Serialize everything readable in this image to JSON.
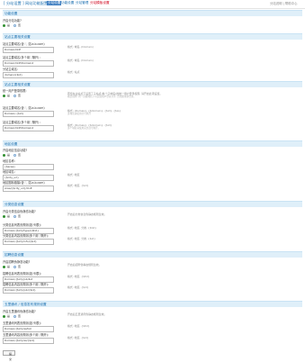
{
  "header": {
    "title": "[ 分站设置 ] 网站功能配置 - 功能",
    "tabs": [
      "分站设置",
      "功能设置",
      "分站管理",
      "分站模板设置"
    ],
    "right": "分站说明  |  帮助中心"
  },
  "sections": [
    {
      "title": "功能设置",
      "rows": [
        {
          "label": "开启分站功能?",
          "type": "radio",
          "options": [
            "是",
            "否"
          ],
          "selected": 0
        }
      ]
    },
    {
      "title": "站点主要相关设置",
      "rows": [
        {
          "label": "站点主要域名(含'.', 如.a.b.com)",
          "type": "input",
          "value": "Domain/OnE",
          "hint": "格式: 域名, (Domain)"
        },
        {
          "label": "站点主要域名(多个用','隔开) :",
          "type": "input",
          "value": "Domain/OnE/Domain2",
          "hint": "格式: 域名, (Domain)"
        },
        {
          "label": "分站主域名:",
          "type": "input",
          "value": "domain/{$id}",
          "hint": "格式: 站点"
        }
      ]
    },
    {
      "title": "站点主要相关设置",
      "rows": [
        {
          "label": "统一用户登录权限:",
          "type": "radio",
          "options": [
            "是",
            "否"
          ],
          "selected": 0,
          "hint": "若您在主站点下设置了子站点(各个子域名)的统一用户登录权限, 请开启此项设置。",
          "hint2": "格式说明: 同一顶级域名下可实现用户登录共享, 否则需重新登录。"
        },
        {
          "label": "站点主要域名(含'.', 如.a.b.com)",
          "type": "input",
          "value": "Domain/.{$id}",
          "hint": "格式: (Domain), {$domain}, {$id}, {$ip}",
          "hint2": "多域名请使用分号隔开"
        },
        {
          "label": "站点主要域名(多个用','隔开) :",
          "type": "input",
          "value": "Domain/OnE/Domain2",
          "hint": "格式: (Domain), {$domain}, {$id}",
          "hint2": "多个域名请使用英文逗号隔开。"
        }
      ]
    },
    {
      "title": "地区设置",
      "rows": [
        {
          "label": "开启地区信息功能?",
          "type": "radio",
          "options": [
            "是",
            "否"
          ],
          "selected": 0
        },
        {
          "label": "地区名称:",
          "type": "input",
          "value": "{$area}"
        },
        {
          "label": "地区域名:",
          "type": "input",
          "value": "{$city_url}",
          "hint": "格式: 地区"
        },
        {
          "label": "地区图标链接(含'.', 如.a.b.com)",
          "type": "input",
          "value": "Area/{$city_url}/OnE",
          "hint": "格式: 地区, {$id}"
        }
      ]
    },
    {
      "title": "分类信息设置",
      "rows": [
        {
          "label": "开启分类信息伪静态功能?",
          "type": "radio",
          "options": [
            "是",
            "否"
          ],
          "selected": 0,
          "hint": "开启后分类信息伪静态规则生效。"
        },
        {
          "label": "分类信息列表页规则(如:列表):",
          "type": "input",
          "value": "Domain/{$id}/type/{$tid}",
          "hint": "格式: 地区, 分类, {$tid}"
        },
        {
          "label": "分类信息内容页规则(多个用','隔开):",
          "type": "input",
          "value": "Domain/{$id}/info/{$id}",
          "hint": "格式: 地区, 分类, {$id}"
        }
      ]
    },
    {
      "title": "招聘信息设置",
      "rows": [
        {
          "label": "开启招聘伪静态功能?",
          "type": "radio",
          "options": [
            "是",
            "否"
          ],
          "selected": 0,
          "hint": "开启后招聘伪静态规则生效。"
        },
        {
          "label": "招聘信息列表页规则(如:列表):",
          "type": "input",
          "value": "Domain/{$id}/job/list",
          "hint": "格式: 地区, {$tid}"
        },
        {
          "label": "招聘信息内容页规则(多个用','隔开):",
          "type": "input",
          "value": "Domain/{$id}/job/{$id}",
          "hint": "格式: 地区, {$id}"
        }
      ]
    },
    {
      "title": "五里通讯 / 信息发布规则设置",
      "rows": [
        {
          "label": "开启五里通讯伪静态功能?",
          "type": "radio",
          "options": [
            "是",
            "否"
          ],
          "selected": 0,
          "hint": "开启后五里通讯伪静态规则生效。"
        },
        {
          "label": "五里通讯列表页规则(如:列表):",
          "type": "input",
          "value": "Domain/{$id}/wl/list",
          "hint": "格式: 地区, {$tid}"
        },
        {
          "label": "五里通讯内容页规则(多个用','隔开):",
          "type": "input",
          "value": "Domain/{$id}/wl/{$id}",
          "hint": "格式: 地区, {$id}"
        }
      ]
    }
  ],
  "save_label": "提交"
}
